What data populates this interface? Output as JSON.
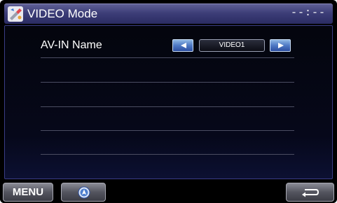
{
  "header": {
    "title": "VIDEO Mode",
    "clock": "--:--",
    "app_icon": "video-settings-icon"
  },
  "setting": {
    "label": "AV-IN Name",
    "value": "VIDEO1",
    "prev_icon": "arrow-left-icon",
    "next_icon": "arrow-right-icon"
  },
  "footer": {
    "menu_label": "MENU",
    "nav_icon": "navigation-icon",
    "back_icon": "back-icon"
  },
  "colors": {
    "title_bar": "#3d3e78",
    "panel_border": "#3a3d86",
    "arrow_button": "#4e79c4",
    "footer_button": "#54555f"
  }
}
